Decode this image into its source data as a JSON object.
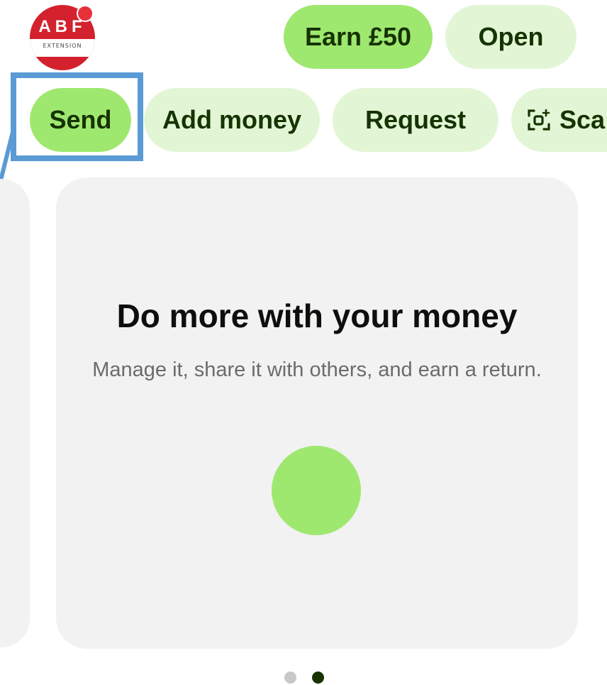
{
  "header": {
    "avatar": {
      "logo_text": "ABF",
      "logo_subtext": "EXTENSION",
      "has_notification": true
    },
    "earn_label": "Earn £50",
    "open_label": "Open"
  },
  "actions": [
    {
      "label": "Send",
      "style": "primary"
    },
    {
      "label": "Add money",
      "style": "secondary"
    },
    {
      "label": "Request",
      "style": "secondary"
    },
    {
      "label": "Sca",
      "icon": "scan-icon",
      "style": "secondary"
    }
  ],
  "card": {
    "title": "Do more with your money",
    "description": "Manage it, share it with others, and earn a return."
  },
  "carousel": {
    "page_count": 2,
    "active_page": 2
  },
  "colors": {
    "primary_green": "#9fe870",
    "secondary_green": "#e2f6d5",
    "dark_green_text": "#163300",
    "card_bg": "#f2f2f2",
    "highlight": "#5b9bd5",
    "logo_red": "#d3212d"
  }
}
